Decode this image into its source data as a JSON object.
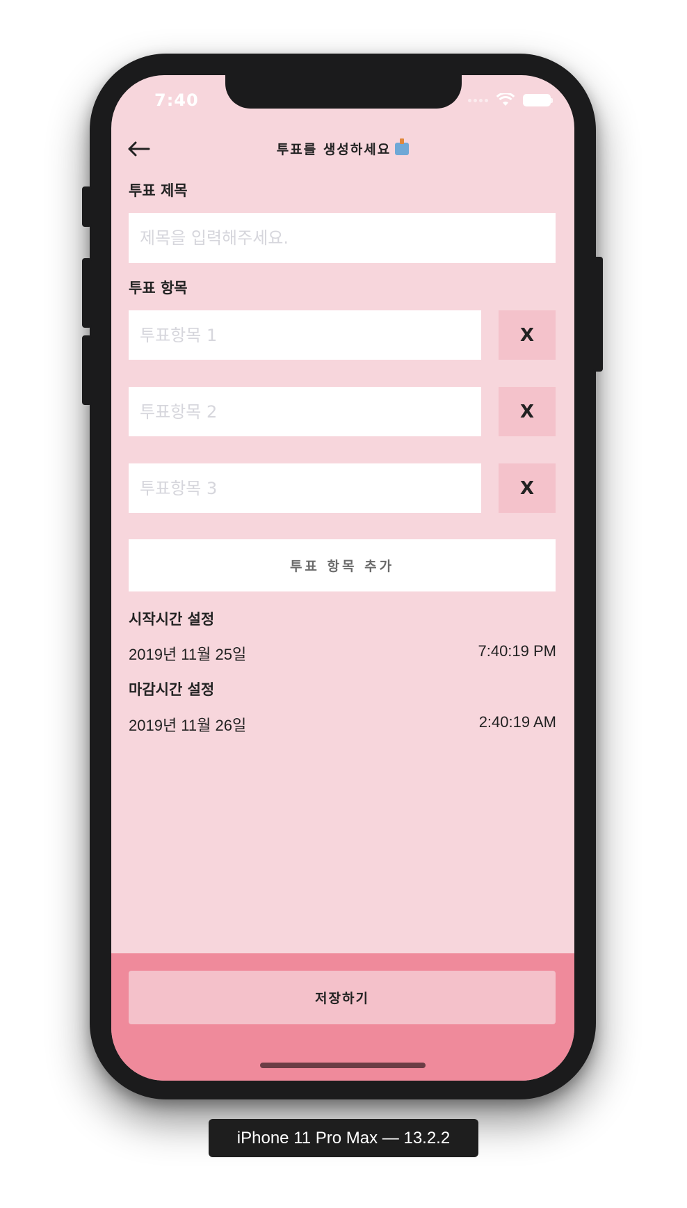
{
  "status_bar": {
    "time": "7:40"
  },
  "header": {
    "title": "투표를 생성하세요",
    "back_icon": "arrow-left-icon",
    "title_icon": "ballot-box-icon"
  },
  "form": {
    "title_label": "투표 제목",
    "title_placeholder": "제목을 입력해주세요.",
    "title_value": "",
    "options_label": "투표 항목",
    "options": [
      {
        "placeholder": "투표항목 1",
        "value": "",
        "remove_label": "X"
      },
      {
        "placeholder": "투표항목 2",
        "value": "",
        "remove_label": "X"
      },
      {
        "placeholder": "투표항목 3",
        "value": "",
        "remove_label": "X"
      }
    ],
    "add_option_label": "투표 항목 추가",
    "start_label": "시작시간 설정",
    "start_date": "2019년 11월 25일",
    "start_time": "7:40:19 PM",
    "end_label": "마감시간 설정",
    "end_date": "2019년 11월 26일",
    "end_time": "2:40:19 AM"
  },
  "footer": {
    "save_label": "저장하기"
  },
  "device": {
    "label": "iPhone 11 Pro Max — 13.2.2"
  },
  "colors": {
    "screen_bg": "#f7d6dc",
    "accent_button": "#f4c2cb",
    "footer_bg": "#ef8a9b",
    "frame": "#1b1b1c"
  }
}
